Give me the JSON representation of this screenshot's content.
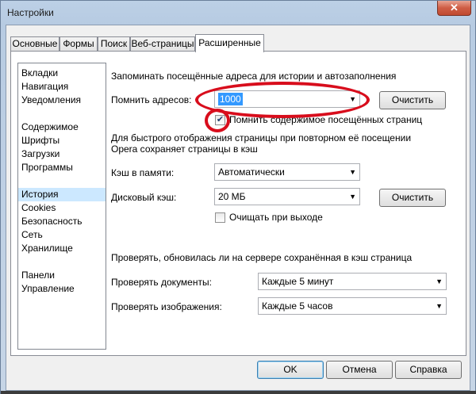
{
  "window": {
    "title": "Настройки",
    "close_label": "✕"
  },
  "tabs": [
    {
      "label": "Основные"
    },
    {
      "label": "Формы"
    },
    {
      "label": "Поиск"
    },
    {
      "label": "Веб-страницы"
    },
    {
      "label": "Расширенные",
      "active": true
    }
  ],
  "sidebar": {
    "items": [
      {
        "label": "Вкладки"
      },
      {
        "label": "Навигация"
      },
      {
        "label": "Уведомления"
      },
      {
        "label": "Содержимое"
      },
      {
        "label": "Шрифты"
      },
      {
        "label": "Загрузки"
      },
      {
        "label": "Программы"
      },
      {
        "label": "История",
        "selected": true
      },
      {
        "label": "Cookies"
      },
      {
        "label": "Безопасность"
      },
      {
        "label": "Сеть"
      },
      {
        "label": "Хранилище"
      },
      {
        "label": "Панели"
      },
      {
        "label": "Управление"
      }
    ]
  },
  "history": {
    "section_title": "Запоминать посещённые адреса для истории и автозаполнения",
    "remember_label": "Помнить адресов:",
    "remember_value": "1000",
    "clear_label": "Очистить",
    "remember_content_label": "Помнить содержимое посещённых страниц",
    "remember_content_checked": true
  },
  "cache": {
    "description_line1": "Для быстрого отображения страницы при повторном её посещении",
    "description_line2": "Opera сохраняет страницы в кэш",
    "memory_label": "Кэш в памяти:",
    "memory_value": "Автоматически",
    "disk_label": "Дисковый кэш:",
    "disk_value": "20 МБ",
    "clear_label": "Очистить",
    "clear_on_exit_label": "Очищать при выходе",
    "clear_on_exit_checked": false
  },
  "check": {
    "title": "Проверять, обновилась ли на сервере сохранённая в кэш страница",
    "documents_label": "Проверять документы:",
    "documents_value": "Каждые 5 минут",
    "images_label": "Проверять изображения:",
    "images_value": "Каждые 5 часов"
  },
  "footer": {
    "ok_label": "OK",
    "cancel_label": "Отмена",
    "help_label": "Справка"
  },
  "icons": {
    "dropdown": "▼",
    "check": "✔"
  },
  "colors": {
    "annotation": "#d80d1c",
    "selection": "#3399ff",
    "list_selected": "#cce8ff"
  }
}
